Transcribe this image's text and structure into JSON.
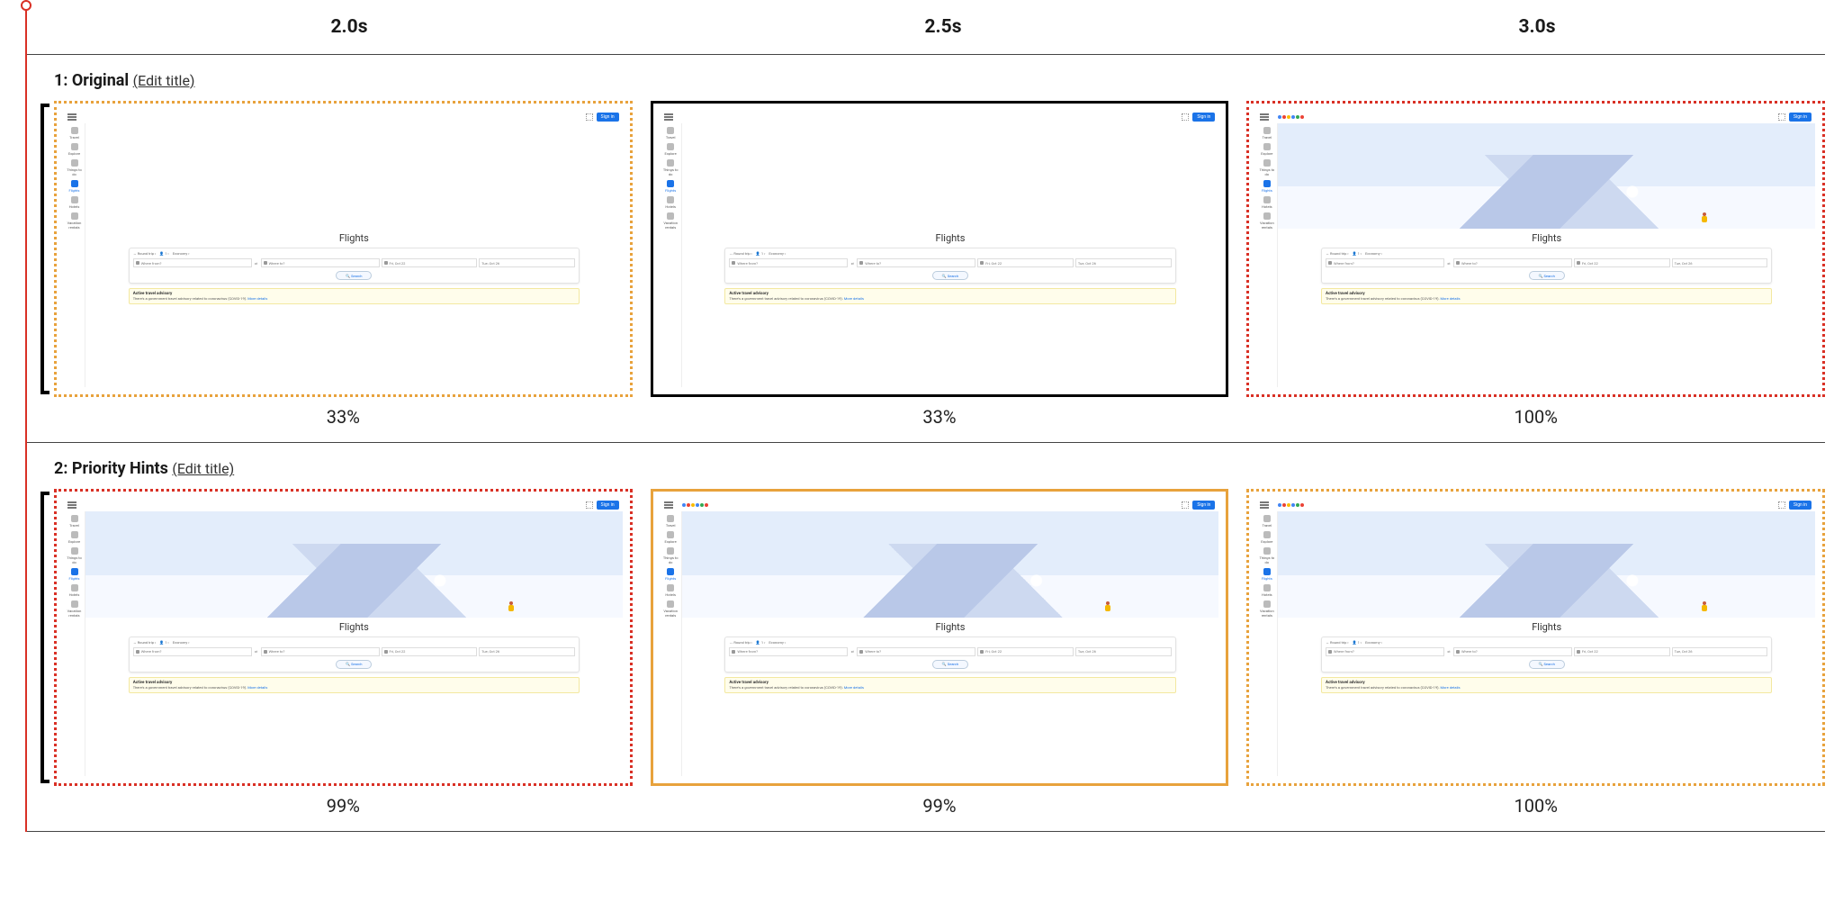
{
  "time_columns": [
    "2.0s",
    "2.5s",
    "3.0s"
  ],
  "rows": [
    {
      "num": "1",
      "name": "Original",
      "edit_label": "(Edit title)",
      "frames": [
        {
          "border": "bd-orange-dotted",
          "left_tick": true,
          "hero": "blank",
          "logo": false,
          "scrollbar": true,
          "percent": "33%"
        },
        {
          "border": "bd-black-solid",
          "left_tick": false,
          "hero": "blank",
          "logo": false,
          "scrollbar": true,
          "percent": "33%"
        },
        {
          "border": "bd-red-dotted",
          "left_tick": false,
          "hero": "full",
          "logo": true,
          "scrollbar": false,
          "percent": "100%"
        }
      ]
    },
    {
      "num": "2",
      "name": "Priority Hints",
      "edit_label": "(Edit title)",
      "frames": [
        {
          "border": "bd-red-dotted",
          "left_tick": true,
          "hero": "full",
          "logo": false,
          "scrollbar": false,
          "percent": "99%"
        },
        {
          "border": "bd-orange-solid",
          "left_tick": false,
          "hero": "full",
          "logo": true,
          "scrollbar": true,
          "percent": "99%"
        },
        {
          "border": "bd-orange-dotted",
          "left_tick": false,
          "hero": "full",
          "logo": true,
          "scrollbar": false,
          "percent": "100%"
        }
      ]
    }
  ],
  "mini_page": {
    "sign_in": "Sign in",
    "brand": "Google",
    "sidebar": [
      {
        "label": "Travel"
      },
      {
        "label": "Explore"
      },
      {
        "label": "Things to do"
      },
      {
        "label": "Flights",
        "active": true
      },
      {
        "label": "Hotels"
      },
      {
        "label": "Vacation rentals"
      }
    ],
    "title": "Flights",
    "chips": {
      "trip": "Round trip",
      "pax": "1",
      "class": "Economy"
    },
    "fields": {
      "from_placeholder": "Where from?",
      "to_placeholder": "Where to?",
      "date_out": "Fri, Oct 22",
      "date_back": "Tue, Oct 26"
    },
    "search_label": "Search",
    "advisory": {
      "title": "Active travel advisory",
      "desc_prefix": "There's a government travel advisory related to coronavirus (COVID-19). ",
      "link": "More details"
    }
  }
}
